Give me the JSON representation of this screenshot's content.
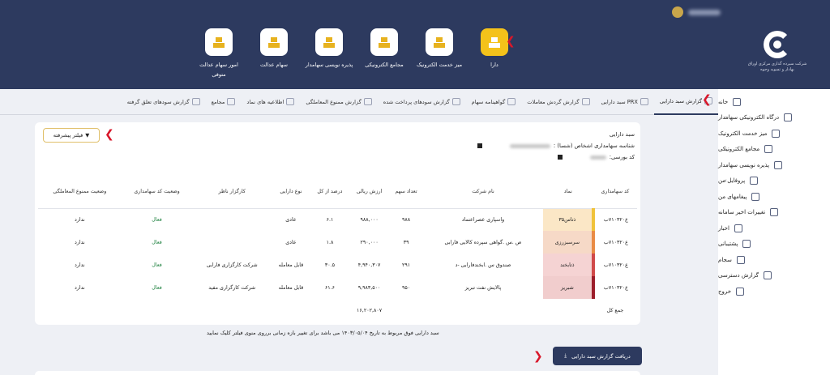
{
  "modules": [
    {
      "label": "دارا",
      "icon": "person-chart-icon",
      "active": true
    },
    {
      "label": "میز خدمت الکترونیک",
      "icon": "service-desk-icon"
    },
    {
      "label": "مجامع الکترونیکی",
      "icon": "meeting-icon"
    },
    {
      "label": "پذیره نویسی سهامدار",
      "icon": "subscription-icon"
    },
    {
      "label": "سهام عدالت",
      "icon": "justice-share-icon"
    },
    {
      "label": "امور سهام عدالت متوفی",
      "icon": "deceased-share-icon"
    }
  ],
  "logo_text": "شرکت سپرده گذاری مرکزی اوراق بهادار و تسویه وجوه",
  "sidebar": [
    {
      "label": "خانه"
    },
    {
      "label": "درگاه الکترونیکی سهامدار",
      "chev": true
    },
    {
      "label": "میز خدمت الکترونیک"
    },
    {
      "label": "مجامع الکترونیکی",
      "chev": true
    },
    {
      "label": "پذیره نویسی سهامدار"
    },
    {
      "label": "پروفایل من",
      "chev": true
    },
    {
      "label": "پیغامهای من"
    },
    {
      "label": "تغییرات اخیر سامانه"
    },
    {
      "label": "اخبار"
    },
    {
      "label": "پشتیبانی"
    },
    {
      "label": "سجام"
    },
    {
      "label": "گزارش دسترسی"
    },
    {
      "label": "خروج"
    }
  ],
  "tabs": [
    {
      "label": "گزارش سبد دارایی",
      "active": true
    },
    {
      "label": "سبد دارایی PRX"
    },
    {
      "label": "گزارش گردش معاملات"
    },
    {
      "label": "گواهینامه سهام"
    },
    {
      "label": "گزارش سودهای پرداخت شده"
    },
    {
      "label": "گزارش ممنوع المعاملگی"
    },
    {
      "label": "اطلاعیه های نماد"
    },
    {
      "label": "مجامع"
    },
    {
      "label": "گزارش سودهای تعلق گرفته"
    }
  ],
  "info": {
    "title": "سبد دارایی",
    "id_label": "شناسه سهامداری اشخاص (شسا) :",
    "code_label": "کد بورسی:"
  },
  "filter_label": "فیلتر پیشرفته",
  "headers": [
    "کد سهامداری",
    "نماد",
    "نام شرکت",
    "تعداد سهم",
    "ارزش ریالی",
    "درصد از کل",
    "نوع دارایی",
    "کارگزار ناظر",
    "وضعیت کد سهامداری",
    "وضعیت ممنوع المعاملگی"
  ],
  "rows": [
    {
      "code": "ع۷۱۰۳۲۰ب",
      "symbol": "ذتاس۳۵",
      "sym_bg": "#fbe7c6",
      "sym_bar": "#f0c23a",
      "company": "واسپاری عصراعتماد",
      "count": "۹۸۸",
      "value": "۹۸۸,۰۰۰",
      "pct": "۶.۱",
      "type": "عادی",
      "broker": "",
      "status": "فعال",
      "ban": "ندارد"
    },
    {
      "code": "ع۷۱۰۳۲۰ب",
      "symbol": "سرسبزرزی",
      "sym_bg": "#f6d9c7",
      "sym_bar": "#e98b45",
      "company": "ص .س .گواهی سپرده کالایی فارابی",
      "count": "۳۹",
      "value": "۲۹۰,۰۰۰",
      "pct": "۱.۸",
      "type": "عادی",
      "broker": "",
      "status": "فعال",
      "ban": "ندارد"
    },
    {
      "code": "ع۷۱۰۳۲۰ب",
      "symbol": "ذتابخند",
      "sym_bg": "#f5d3d3",
      "sym_bar": "#d04a4a",
      "company": "صندوق س .ابخندفارابی -د",
      "count": "۲۹۱",
      "value": "۴,۹۴۰,۳۰۷",
      "pct": "۳۰.۵",
      "type": "قابل معامله",
      "broker": "شرکت کارگزاری فارابی",
      "status": "فعال",
      "ban": "ندارد"
    },
    {
      "code": "ع۷۱۰۳۲۰ب",
      "symbol": "شبریز",
      "sym_bg": "#f1cdcd",
      "sym_bar": "#9c1d2a",
      "company": "پالایش نفت تبریز",
      "count": "۹۵۰",
      "value": "۹,۹۸۳,۵۰۰",
      "pct": "۶۱.۶",
      "type": "قابل معامله",
      "broker": "شرکت کارگزاری مفید",
      "status": "فعال",
      "ban": "ندارد"
    }
  ],
  "total_label": "جمع کل",
  "total_value": "۱۶,۲۰۲,۸۰۷",
  "note": "سبد دارایی فوق مربوط به تاریخ ۱۴۰۳/۰۵/۰۴ می باشد برای تغییر بازه زمانی برروی منوی فیلتر کلیک نمایید",
  "download_label": "دریافت گزارش سبد دارایی"
}
